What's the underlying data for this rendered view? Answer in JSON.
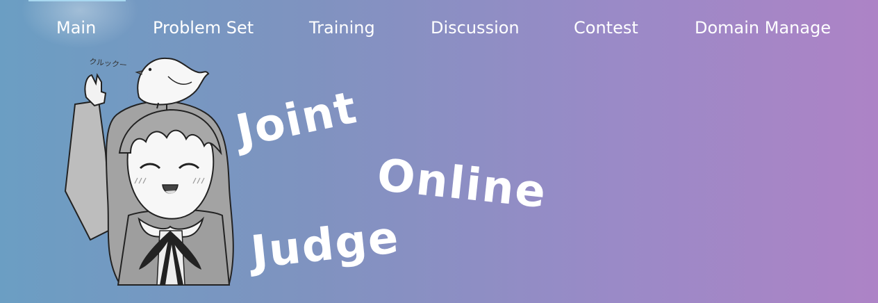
{
  "nav": {
    "items": [
      {
        "label": "Main",
        "active": true
      },
      {
        "label": "Problem Set",
        "active": false
      },
      {
        "label": "Training",
        "active": false
      },
      {
        "label": "Discussion",
        "active": false
      },
      {
        "label": "Contest",
        "active": false
      },
      {
        "label": "Domain Manage",
        "active": false
      }
    ]
  },
  "logo": {
    "line1": "Joint",
    "line2": "Online",
    "line3": "Judge",
    "bird_sound": "クルックー"
  },
  "colors": {
    "gradient_left": "#6b9ec3",
    "gradient_right": "#ad83c6",
    "active_indicator": "#a8d8f0",
    "text": "#ffffff"
  }
}
